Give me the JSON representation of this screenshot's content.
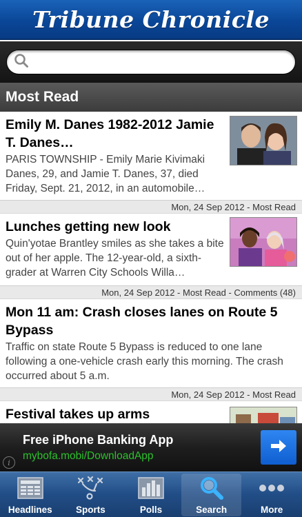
{
  "masthead": {
    "title": "Tribune Chronicle"
  },
  "search": {
    "placeholder": "",
    "value": ""
  },
  "section": {
    "title": "Most Read"
  },
  "articles": [
    {
      "headline": "Emily M. Danes 1982-2012 Jamie T. Danes…",
      "summary": "PARIS TOWNSHIP - Emily Marie Kivimaki Danes, 29, and Jamie T. Danes, 37, died Friday, Sept. 21, 2012, in an automobile…",
      "meta": "Mon, 24 Sep 2012 - Most Read",
      "thumb": "couple-photo"
    },
    {
      "headline": "Lunches getting new look",
      "summary": "Quin'yotae Brantley smiles as she takes a bite out of her apple.  The 12-year-old, a sixth-grader at Warren City Schools Willa…",
      "meta": "Mon, 24 Sep 2012 - Most Read - Comments (48)",
      "thumb": "students-photo"
    },
    {
      "headline": "Mon 11 am: Crash closes lanes on Route 5 Bypass",
      "summary": " Traffic on state Route 5 Bypass is reduced to one lane following a one-vehicle crash early this morning. The crash occurred about 5 a.m.",
      "meta": "Mon, 24 Sep 2012 - Most Read"
    },
    {
      "headline": "Festival takes up arms",
      "thumb": "festival-photo"
    }
  ],
  "ad": {
    "title": "Free iPhone Banking App",
    "link": "mybofa.mobi/DownloadApp"
  },
  "tabs": [
    {
      "label": "Headlines",
      "icon": "newspaper-icon"
    },
    {
      "label": "Sports",
      "icon": "playbook-icon"
    },
    {
      "label": "Polls",
      "icon": "bar-chart-icon"
    },
    {
      "label": "Search",
      "icon": "search-icon",
      "active": true
    },
    {
      "label": "More",
      "icon": "more-dots-icon"
    }
  ],
  "colors": {
    "masthead": "#0a4698",
    "tabbar": "#214d86",
    "ad_link": "#2cc12c",
    "ad_button": "#1a6ee0"
  }
}
